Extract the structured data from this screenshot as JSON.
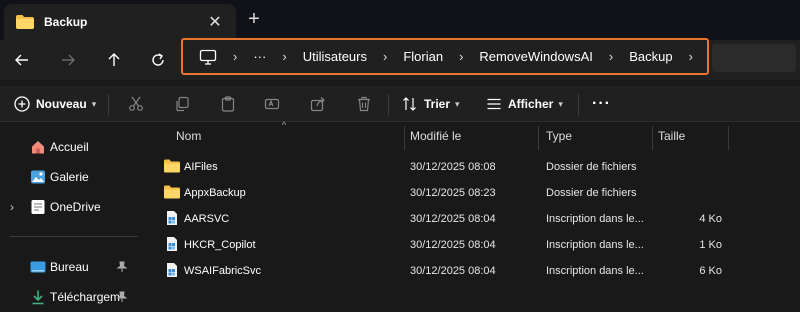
{
  "window": {
    "tab_title": "Backup",
    "tab_icon": "folder-icon",
    "close_glyph": "✕",
    "new_tab_glyph": "+"
  },
  "address_bar": {
    "more_glyph": "···",
    "segments": [
      "Utilisateurs",
      "Florian",
      "RemoveWindowsAI",
      "Backup"
    ],
    "separator": "›",
    "highlight_color": "#e8762d"
  },
  "toolbar": {
    "new_label": "Nouveau",
    "sort_label": "Trier",
    "view_label": "Afficher",
    "more_glyph": "···",
    "caret": "⌄"
  },
  "sidebar": {
    "items": [
      {
        "label": "Accueil",
        "icon": "home-icon"
      },
      {
        "label": "Galerie",
        "icon": "gallery-icon"
      },
      {
        "label": "OneDrive",
        "icon": "onedrive-icon"
      },
      {
        "label": "Bureau",
        "icon": "desktop-icon"
      },
      {
        "label": "Téléchargem",
        "icon": "download-icon"
      }
    ],
    "expand_glyph": "›"
  },
  "file_list": {
    "columns": {
      "name": "Nom",
      "modified": "Modifié le",
      "type": "Type",
      "size": "Taille"
    },
    "sort_glyph": "^",
    "rows": [
      {
        "name": "AIFiles",
        "modified": "30/12/2025 08:08",
        "type": "Dossier de fichiers",
        "size": "",
        "icon": "folder-icon"
      },
      {
        "name": "AppxBackup",
        "modified": "30/12/2025 08:23",
        "type": "Dossier de fichiers",
        "size": "",
        "icon": "folder-icon"
      },
      {
        "name": "AARSVC",
        "modified": "30/12/2025 08:04",
        "type": "Inscription dans le...",
        "size": "4 Ko",
        "icon": "registry-file-icon"
      },
      {
        "name": "HKCR_Copilot",
        "modified": "30/12/2025 08:04",
        "type": "Inscription dans le...",
        "size": "1 Ko",
        "icon": "registry-file-icon"
      },
      {
        "name": "WSAIFabricSvc",
        "modified": "30/12/2025 08:04",
        "type": "Inscription dans le...",
        "size": "6 Ko",
        "icon": "registry-file-icon"
      }
    ]
  }
}
